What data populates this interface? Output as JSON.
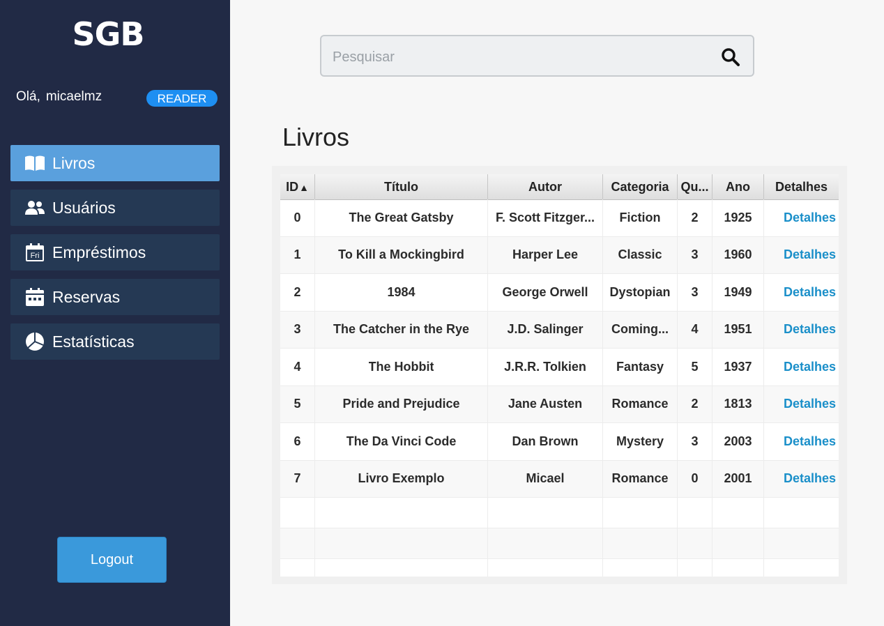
{
  "app": {
    "logo": "SGB"
  },
  "user": {
    "greeting": "Olá,",
    "username": "micaelmz",
    "role": "READER"
  },
  "sidebar": {
    "items": [
      {
        "label": "Livros",
        "icon": "book-open-icon",
        "active": true
      },
      {
        "label": "Usuários",
        "icon": "users-icon",
        "active": false
      },
      {
        "label": "Empréstimos",
        "icon": "calendar-day-icon",
        "active": false
      },
      {
        "label": "Reservas",
        "icon": "calendar-dots-icon",
        "active": false
      },
      {
        "label": "Estatísticas",
        "icon": "pie-chart-icon",
        "active": false
      }
    ],
    "logout_label": "Logout"
  },
  "icons": {
    "calendar_day_text": "Fri"
  },
  "search": {
    "placeholder": "Pesquisar",
    "value": ""
  },
  "page": {
    "title": "Livros"
  },
  "table": {
    "columns": [
      "ID",
      "Título",
      "Autor",
      "Categoria",
      "Qu...",
      "Ano",
      "Detalhes"
    ],
    "sort_indicator": "▲",
    "rows": [
      [
        "0",
        "The Great Gatsby",
        "F. Scott Fitzger...",
        "Fiction",
        "2",
        "1925",
        "Detalhes"
      ],
      [
        "1",
        "To Kill a Mockingbird",
        "Harper Lee",
        "Classic",
        "3",
        "1960",
        "Detalhes"
      ],
      [
        "2",
        "1984",
        "George Orwell",
        "Dystopian",
        "3",
        "1949",
        "Detalhes"
      ],
      [
        "3",
        "The Catcher in the Rye",
        "J.D. Salinger",
        "Coming...",
        "4",
        "1951",
        "Detalhes"
      ],
      [
        "4",
        "The Hobbit",
        "J.R.R. Tolkien",
        "Fantasy",
        "5",
        "1937",
        "Detalhes"
      ],
      [
        "5",
        "Pride and Prejudice",
        "Jane Austen",
        "Romance",
        "2",
        "1813",
        "Detalhes"
      ],
      [
        "6",
        "The Da Vinci Code",
        "Dan Brown",
        "Mystery",
        "3",
        "2003",
        "Detalhes"
      ],
      [
        "7",
        "Livro Exemplo",
        "Micael",
        "Romance",
        "0",
        "2001",
        "Detalhes"
      ]
    ]
  },
  "colors": {
    "sidebar_bg": "#212a45",
    "nav_active": "#5aa0dd",
    "nav_item": "#253954",
    "badge": "#1e8ff2",
    "link": "#1a8fc9",
    "logout": "#3a99db"
  }
}
